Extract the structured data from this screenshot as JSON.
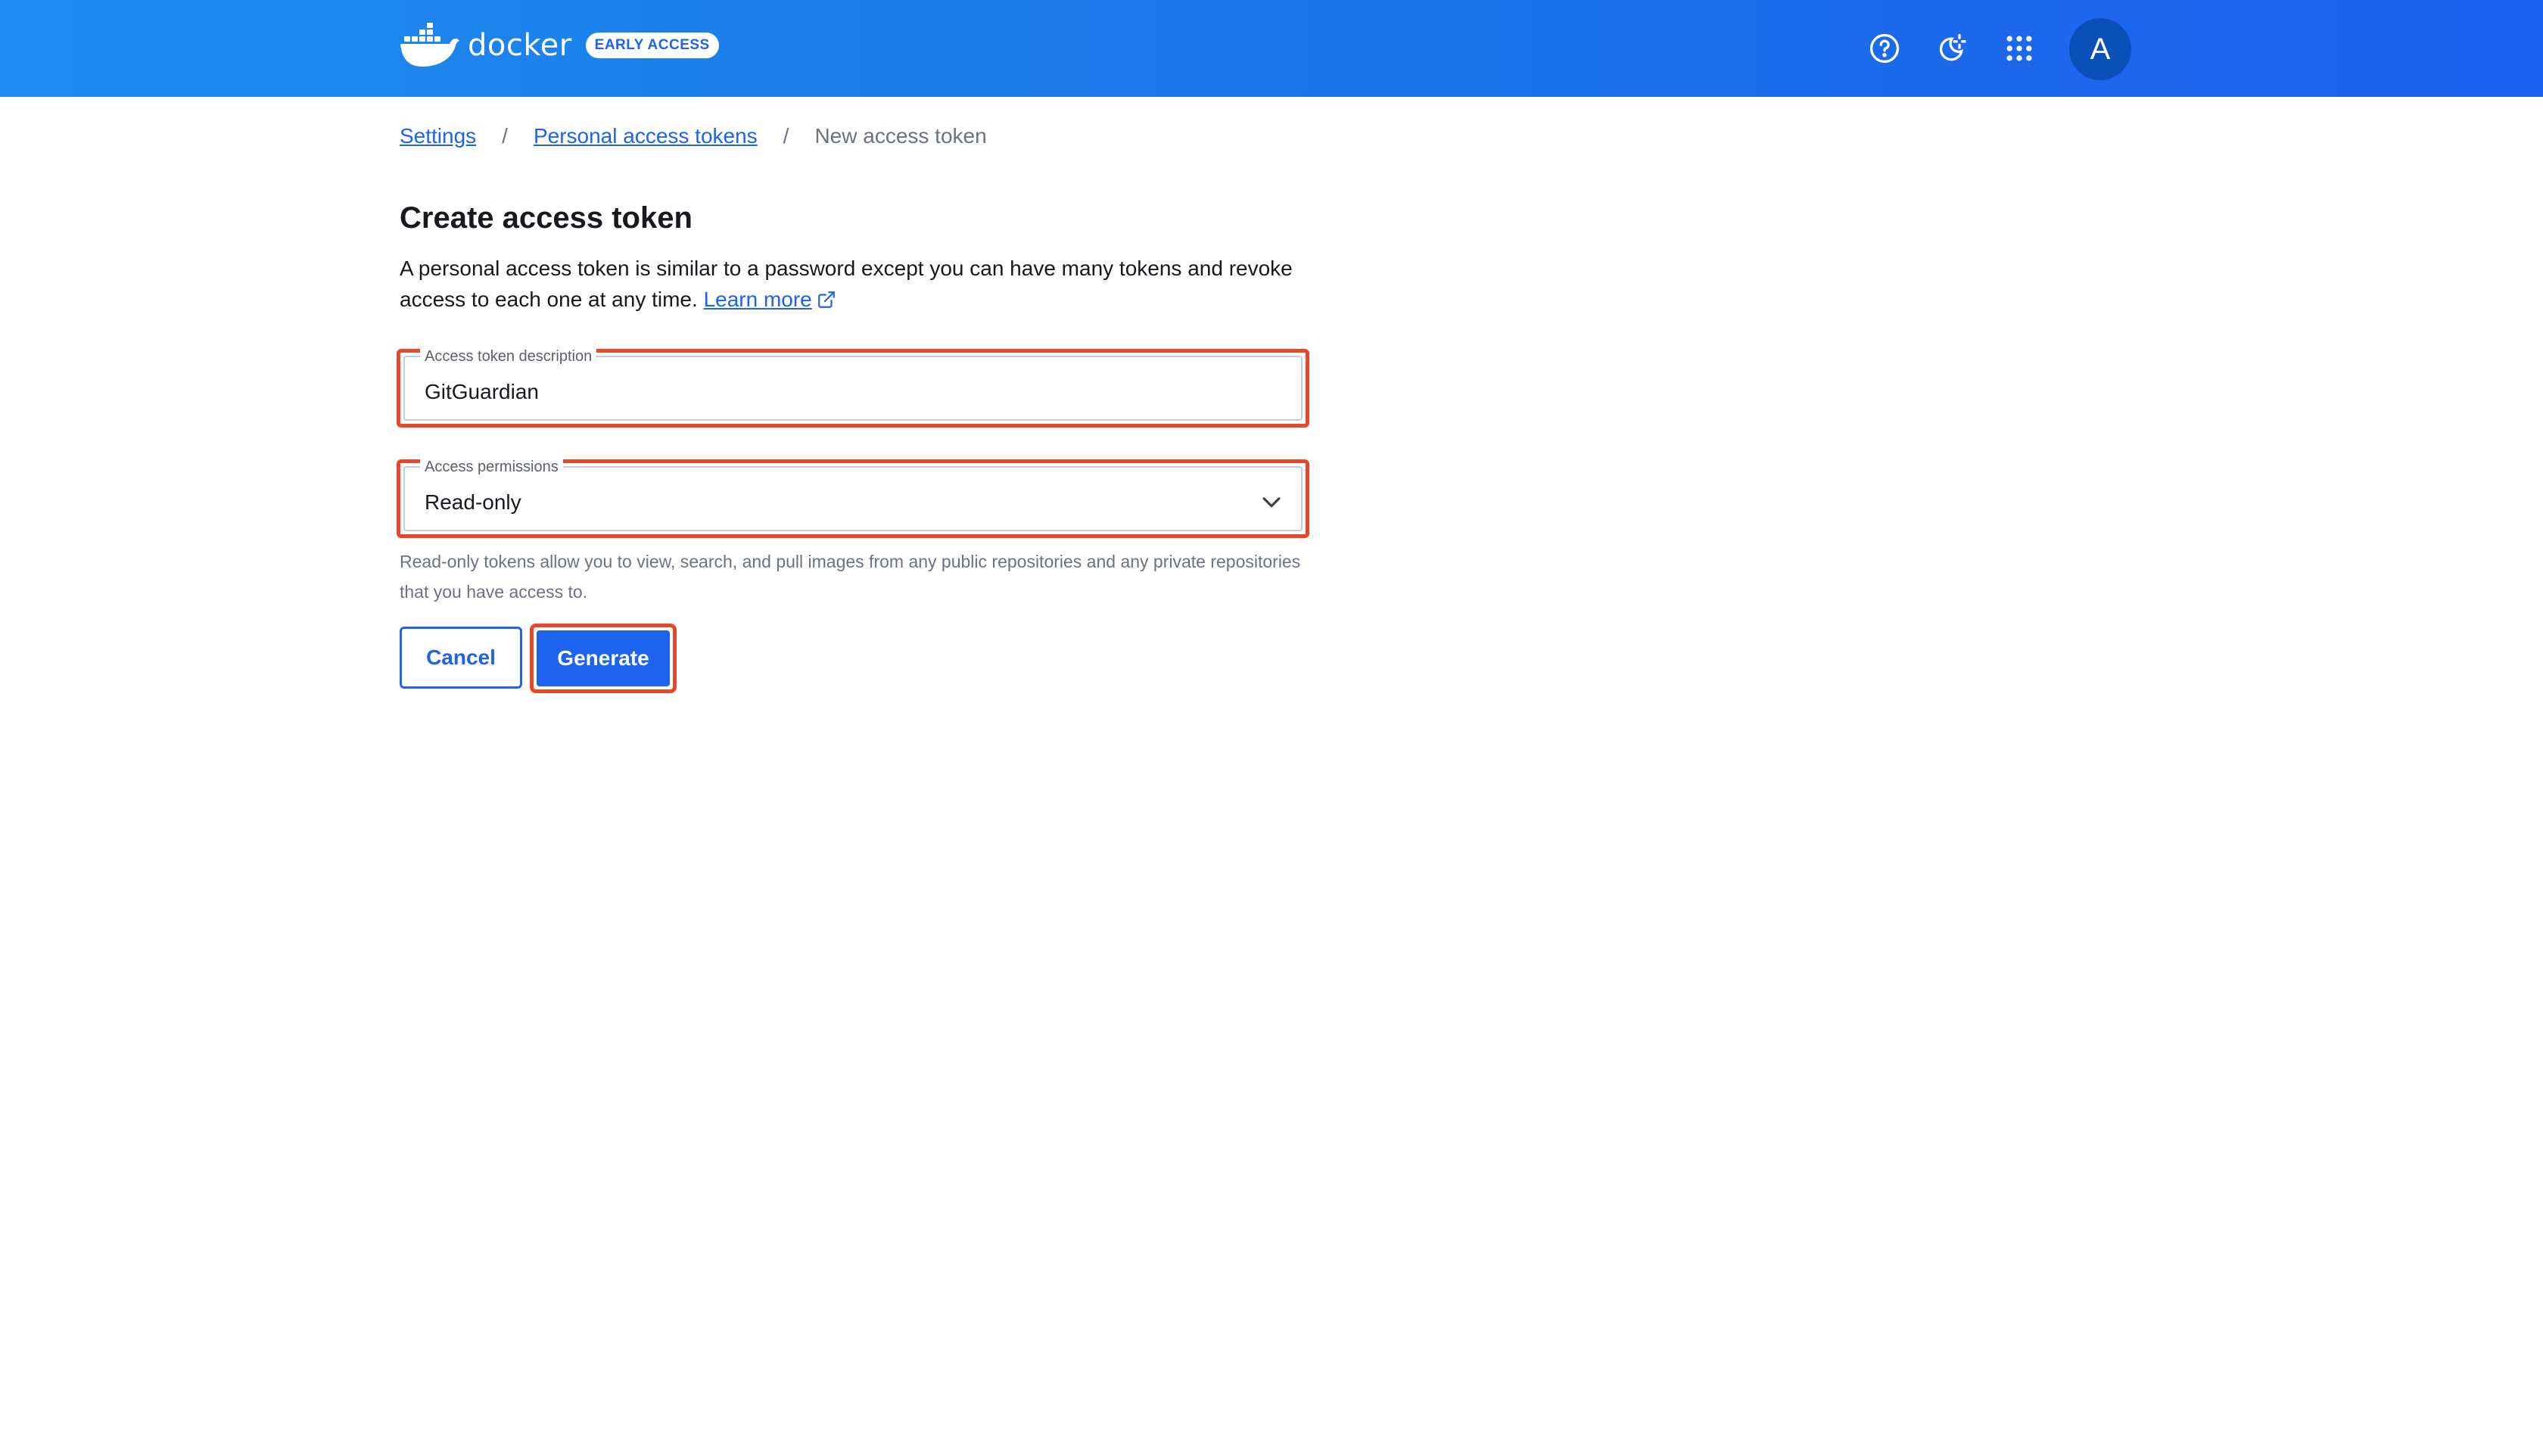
{
  "header": {
    "brand_name": "docker",
    "badge": "EARLY ACCESS",
    "icons": [
      "help-icon",
      "theme-toggle-icon",
      "apps-grid-icon"
    ],
    "avatar_initial": "A",
    "colors": {
      "gradient_start": "#1e8cf0",
      "gradient_end": "#1d5ff0"
    }
  },
  "breadcrumb": {
    "items": [
      "Settings",
      "Personal access tokens"
    ],
    "current": "New access token",
    "separator": "/"
  },
  "main": {
    "title": "Create access token",
    "intro_text": "A personal access token is similar to a password except you can have many tokens and revoke access to each one at any time.",
    "learn_more": "Learn more"
  },
  "form": {
    "description_label": "Access token description",
    "description_value": "GitGuardian",
    "permissions_label": "Access permissions",
    "permissions_value": "Read-only",
    "helper_text": "Read-only tokens allow you to view, search, and pull images from any public repositories and any private repositories that you have access to."
  },
  "actions": {
    "cancel_label": "Cancel",
    "generate_label": "Generate"
  },
  "colors": {
    "accent": "#1d63ed",
    "highlight": "#e8472a"
  }
}
